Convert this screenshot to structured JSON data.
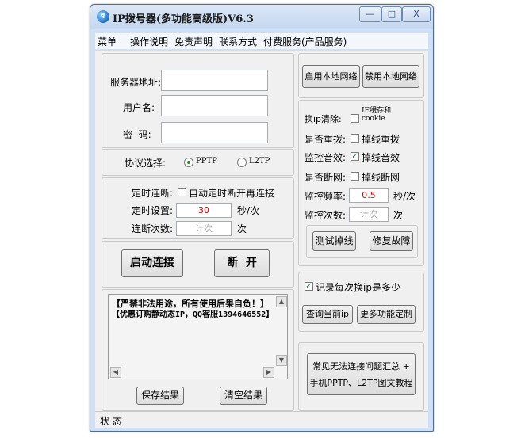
{
  "window": {
    "title": "IP拨号器(多功能高级版)V6.3",
    "controls": {
      "minimize": "—",
      "maximize": "□",
      "close": "X"
    }
  },
  "menu": {
    "items": [
      "菜单",
      "操作说明",
      "免责声明",
      "联系方式",
      "付费服务(产品服务)"
    ]
  },
  "server": {
    "address_label": "服务器地址:",
    "address_value": "",
    "user_label": "用户名:",
    "user_value": "",
    "password_label": "密  码:",
    "password_value": ""
  },
  "protocol": {
    "label": "协议选择:",
    "options": [
      "PPTP",
      "L2TP"
    ],
    "selected": "PPTP"
  },
  "timer": {
    "disconnect_label": "定时连断:",
    "auto_reconnect_label": "自动定时断开再连接",
    "auto_reconnect_checked": false,
    "set_label": "定时设置:",
    "interval_value": "30",
    "interval_unit": "秒/次",
    "count_label": "连断次数:",
    "count_placeholder": "计次",
    "count_unit": "次"
  },
  "actions": {
    "start": "启动连接",
    "disconnect": "断  开"
  },
  "log": {
    "lines": [
      "【严禁非法用途，所有使用后果自负！】",
      "【优惠订购静动态IP，QQ客服1394646552】"
    ],
    "save": "保存结果",
    "clear": "清空结果"
  },
  "network": {
    "enable": "启用本地网络",
    "disable": "禁用本地网络"
  },
  "options": {
    "clear_label": "换ip清除:",
    "clear_option": "IE缓存和cookie",
    "redial_label": "是否重拨:",
    "redial_option": "掉线重拨",
    "sound_label": "监控音效:",
    "sound_option": "掉线音效",
    "cutnet_label": "是否断网:",
    "cutnet_option": "掉线断网",
    "freq_label": "监控频率:",
    "freq_value": "0.5",
    "freq_unit": "秒/次",
    "times_label": "监控次数:",
    "times_placeholder": "计次",
    "times_unit": "次",
    "test_button": "测试掉线",
    "repair_button": "修复故障",
    "checked": {
      "clear": false,
      "redial": false,
      "sound": true,
      "cutnet": false
    }
  },
  "record": {
    "label": "记录每次换ip是多少",
    "checked": true,
    "query_button": "查询当前ip",
    "custom_button": "更多功能定制"
  },
  "help": {
    "line1": "常见无法连接问题汇总 +",
    "line2": "手机PPTP、L2TP图文教程"
  },
  "status": {
    "label": "状 态"
  },
  "colors": {
    "titlebar": "#c4d7ef",
    "accent_red": "#d40000"
  }
}
